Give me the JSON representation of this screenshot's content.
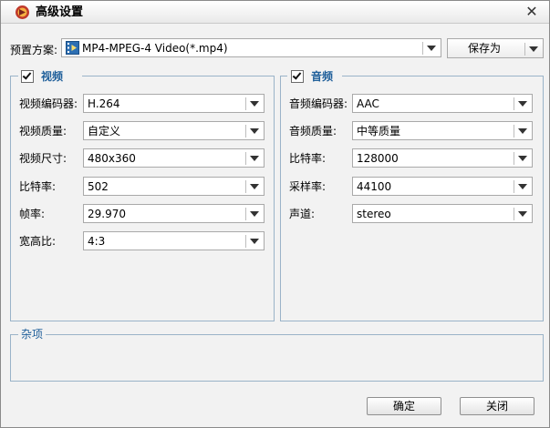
{
  "window": {
    "title": "高级设置",
    "close_glyph": "✕"
  },
  "preset": {
    "label": "预置方案:",
    "value": "MP4-MPEG-4 Video(*.mp4)",
    "save_as_label": "保存为"
  },
  "video": {
    "title": "视频",
    "checked": true,
    "fields": [
      {
        "label": "视频编码器:",
        "value": "H.264"
      },
      {
        "label": "视频质量:",
        "value": "自定义"
      },
      {
        "label": "视频尺寸:",
        "value": "480x360"
      },
      {
        "label": "比特率:",
        "value": "502"
      },
      {
        "label": "帧率:",
        "value": "29.970"
      },
      {
        "label": "宽高比:",
        "value": "4:3"
      }
    ]
  },
  "audio": {
    "title": "音频",
    "checked": true,
    "fields": [
      {
        "label": "音频编码器:",
        "value": "AAC"
      },
      {
        "label": "音频质量:",
        "value": "中等质量"
      },
      {
        "label": "比特率:",
        "value": "128000"
      },
      {
        "label": "采样率:",
        "value": "44100"
      },
      {
        "label": "声道:",
        "value": "stereo"
      }
    ]
  },
  "misc": {
    "title": "杂项"
  },
  "footer": {
    "ok_label": "确定",
    "close_label": "关闭"
  }
}
